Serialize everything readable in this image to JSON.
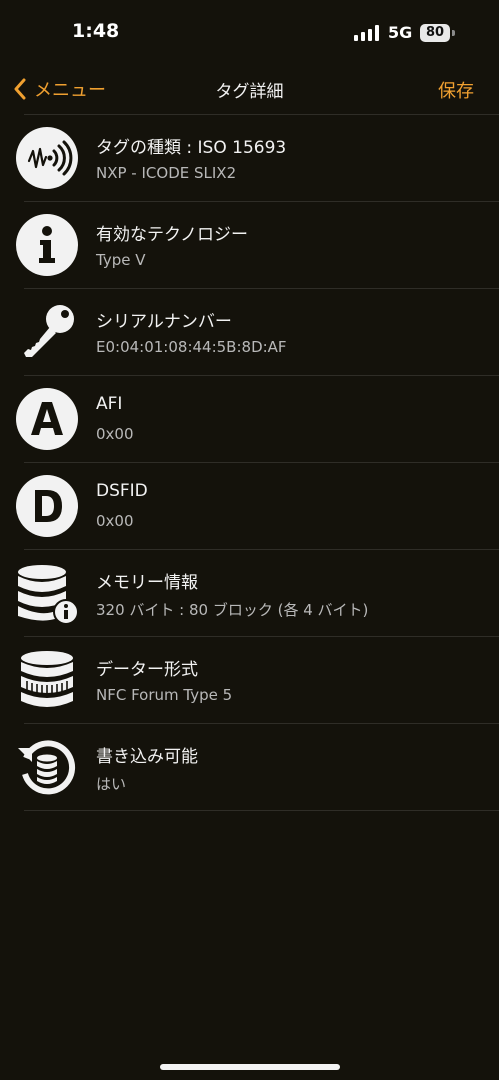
{
  "status": {
    "time": "1:48",
    "network": "5G",
    "battery": "80"
  },
  "nav": {
    "back_label": "メニュー",
    "title": "タグ詳細",
    "save_label": "保存"
  },
  "rows": [
    {
      "icon": "nfc-wave-icon",
      "title": "タグの種類 : ISO 15693",
      "value": "NXP - ICODE SLIX2"
    },
    {
      "icon": "info-icon",
      "title": "有効なテクノロジー",
      "value": "Type V"
    },
    {
      "icon": "key-icon",
      "title": "シリアルナンバー",
      "value": "E0:04:01:08:44:5B:8D:AF"
    },
    {
      "icon": "letter-a-icon",
      "title": "AFI",
      "value": "0x00"
    },
    {
      "icon": "letter-d-icon",
      "title": "DSFID",
      "value": "0x00"
    },
    {
      "icon": "database-info-icon",
      "title": "メモリー情報",
      "value": "320 バイト : 80 ブロック (各 4 バイト)"
    },
    {
      "icon": "coin-stack-icon",
      "title": "データー形式",
      "value": "NFC Forum Type 5"
    },
    {
      "icon": "database-refresh-icon",
      "title": "書き込み可能",
      "value": "はい"
    }
  ]
}
